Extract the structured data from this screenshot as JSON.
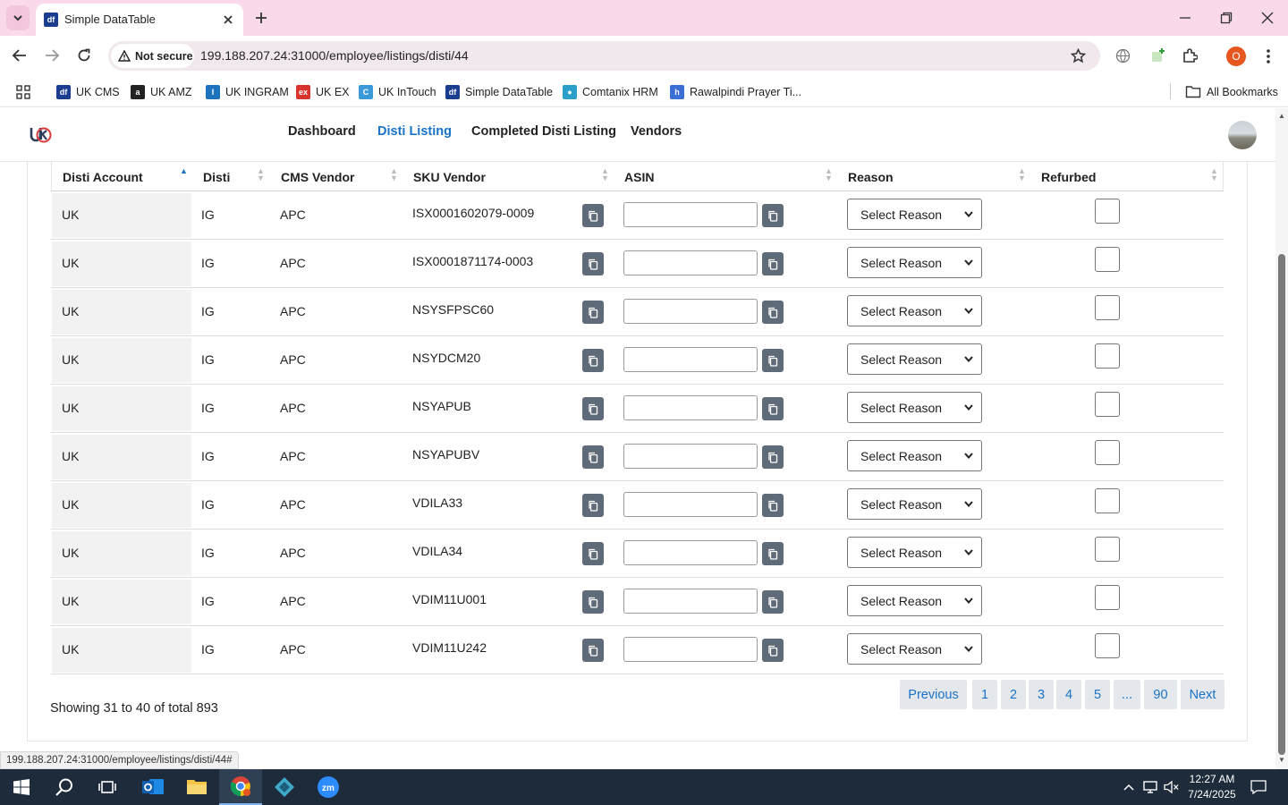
{
  "browser": {
    "tab_title": "Simple DataTable",
    "security_label": "Not secure",
    "url": "199.188.207.24:31000/employee/listings/disti/44",
    "profile_initial": "O",
    "all_bookmarks_label": "All Bookmarks",
    "status_url": "199.188.207.24:31000/employee/listings/disti/44#"
  },
  "bookmarks": [
    {
      "label": "UK CMS",
      "icon": "df-icon",
      "color": "#1b3d8f",
      "glyph": "df"
    },
    {
      "label": "UK AMZ",
      "icon": "amazon-icon",
      "color": "#222222",
      "glyph": "a"
    },
    {
      "label": "UK INGRAM",
      "icon": "ingram-icon",
      "color": "#1e73be",
      "glyph": "I"
    },
    {
      "label": "UK EX",
      "icon": "ex-icon",
      "color": "#d6342c",
      "glyph": "ex"
    },
    {
      "label": "UK InTouch",
      "icon": "intouch-icon",
      "color": "#3a9ad9",
      "glyph": "C"
    },
    {
      "label": "Simple DataTable",
      "icon": "df-icon",
      "color": "#1b3d8f",
      "glyph": "df"
    },
    {
      "label": "Comtanix HRM",
      "icon": "comtanix-icon",
      "color": "#2b9ec9",
      "glyph": "●"
    },
    {
      "label": "Rawalpindi Prayer Ti...",
      "icon": "prayer-icon",
      "color": "#3b6fd6",
      "glyph": "h"
    }
  ],
  "nav": {
    "logo_text": "UK",
    "links": [
      {
        "label": "Dashboard",
        "active": false
      },
      {
        "label": "Disti Listing",
        "active": true
      },
      {
        "label": "Completed Disti Listing",
        "active": false
      },
      {
        "label": "Vendors",
        "active": false
      }
    ]
  },
  "table": {
    "columns": [
      "Disti Account",
      "Disti",
      "CMS Vendor",
      "SKU Vendor",
      "ASIN",
      "Reason",
      "Refurbed"
    ],
    "reason_placeholder": "Select Reason",
    "rows": [
      {
        "account": "UK",
        "disti": "IG",
        "vendor": "APC",
        "sku": "ISX0001602079-0009",
        "asin": "",
        "reason": "Select Reason",
        "refurbed": false
      },
      {
        "account": "UK",
        "disti": "IG",
        "vendor": "APC",
        "sku": "ISX0001871174-0003",
        "asin": "",
        "reason": "Select Reason",
        "refurbed": false
      },
      {
        "account": "UK",
        "disti": "IG",
        "vendor": "APC",
        "sku": "NSYSFPSC60",
        "asin": "",
        "reason": "Select Reason",
        "refurbed": false
      },
      {
        "account": "UK",
        "disti": "IG",
        "vendor": "APC",
        "sku": "NSYDCM20",
        "asin": "",
        "reason": "Select Reason",
        "refurbed": false
      },
      {
        "account": "UK",
        "disti": "IG",
        "vendor": "APC",
        "sku": "NSYAPUB",
        "asin": "",
        "reason": "Select Reason",
        "refurbed": false
      },
      {
        "account": "UK",
        "disti": "IG",
        "vendor": "APC",
        "sku": "NSYAPUBV",
        "asin": "",
        "reason": "Select Reason",
        "refurbed": false
      },
      {
        "account": "UK",
        "disti": "IG",
        "vendor": "APC",
        "sku": "VDILA33",
        "asin": "",
        "reason": "Select Reason",
        "refurbed": false
      },
      {
        "account": "UK",
        "disti": "IG",
        "vendor": "APC",
        "sku": "VDILA34",
        "asin": "",
        "reason": "Select Reason",
        "refurbed": false
      },
      {
        "account": "UK",
        "disti": "IG",
        "vendor": "APC",
        "sku": "VDIM11U001",
        "asin": "",
        "reason": "Select Reason",
        "refurbed": false
      },
      {
        "account": "UK",
        "disti": "IG",
        "vendor": "APC",
        "sku": "VDIM11U242",
        "asin": "",
        "reason": "Select Reason",
        "refurbed": false
      }
    ]
  },
  "footer": {
    "info": "Showing 31 to 40 of total 893",
    "pagination": {
      "previous": "Previous",
      "pages": [
        "1",
        "2",
        "3",
        "4",
        "5",
        "...",
        "90"
      ],
      "next": "Next"
    }
  },
  "taskbar": {
    "time": "12:27 AM",
    "date": "7/24/2025",
    "apps": [
      "start-icon",
      "search-icon",
      "task-view-icon",
      "outlook-icon",
      "file-explorer-icon",
      "chrome-icon",
      "app-icon",
      "zoom-icon"
    ]
  },
  "colors": {
    "accent": "#1a73c7",
    "tab_bar": "#f9d9ea",
    "profile": "#e8561f",
    "taskbar": "#1d2b3a"
  }
}
